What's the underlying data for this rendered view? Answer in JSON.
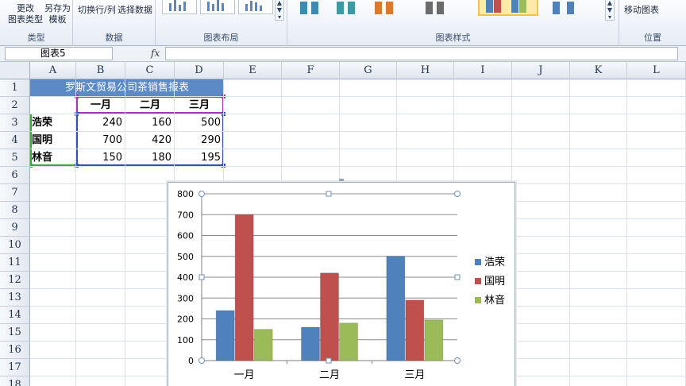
{
  "ribbon": {
    "type_group": {
      "label": "类型",
      "change_type": [
        "更改",
        "图表类型"
      ],
      "save_template": [
        "另存为",
        "模板"
      ]
    },
    "data_group": {
      "label": "数据",
      "switch_row_col": "切换行/列",
      "select_data": "选择数据"
    },
    "layout_group": {
      "label": "图表布局"
    },
    "style_group": {
      "label": "图表样式",
      "selected_style_index": 4
    },
    "location_group": {
      "label": "位置",
      "move_chart": "移动图表"
    }
  },
  "formula_bar": {
    "name_box": "图表5",
    "fx_label": "fx",
    "formula": ""
  },
  "columns": [
    "A",
    "B",
    "C",
    "D",
    "E",
    "F",
    "G",
    "H",
    "I",
    "J",
    "K",
    "L"
  ],
  "rows": [
    "1",
    "2",
    "3",
    "4",
    "5",
    "6",
    "7",
    "8",
    "9",
    "10",
    "11",
    "12",
    "13",
    "14",
    "15",
    "16",
    "17",
    "18"
  ],
  "sheet": {
    "title": "罗斯文贸易公司茶销售报表",
    "headers": [
      "一月",
      "二月",
      "三月"
    ],
    "data_rows": [
      {
        "label": "浩荣",
        "values": [
          "240",
          "160",
          "500"
        ]
      },
      {
        "label": "国明",
        "values": [
          "700",
          "420",
          "290"
        ]
      },
      {
        "label": "林音",
        "values": [
          "150",
          "180",
          "195"
        ]
      }
    ]
  },
  "colors": {
    "series1": "#4f81bd",
    "series2": "#c0504d",
    "series3": "#9bbb59",
    "title_fill": "#5b8ac6"
  },
  "chart_data": {
    "type": "bar",
    "categories": [
      "一月",
      "二月",
      "三月"
    ],
    "series": [
      {
        "name": "浩荣",
        "values": [
          240,
          160,
          500
        ]
      },
      {
        "name": "国明",
        "values": [
          700,
          420,
          290
        ]
      },
      {
        "name": "林音",
        "values": [
          150,
          180,
          195
        ]
      }
    ],
    "title": "",
    "xlabel": "",
    "ylabel": "",
    "ylim": [
      0,
      800
    ],
    "yticks": [
      0,
      100,
      200,
      300,
      400,
      500,
      600,
      700,
      800
    ],
    "grid": true,
    "legend": "right"
  }
}
